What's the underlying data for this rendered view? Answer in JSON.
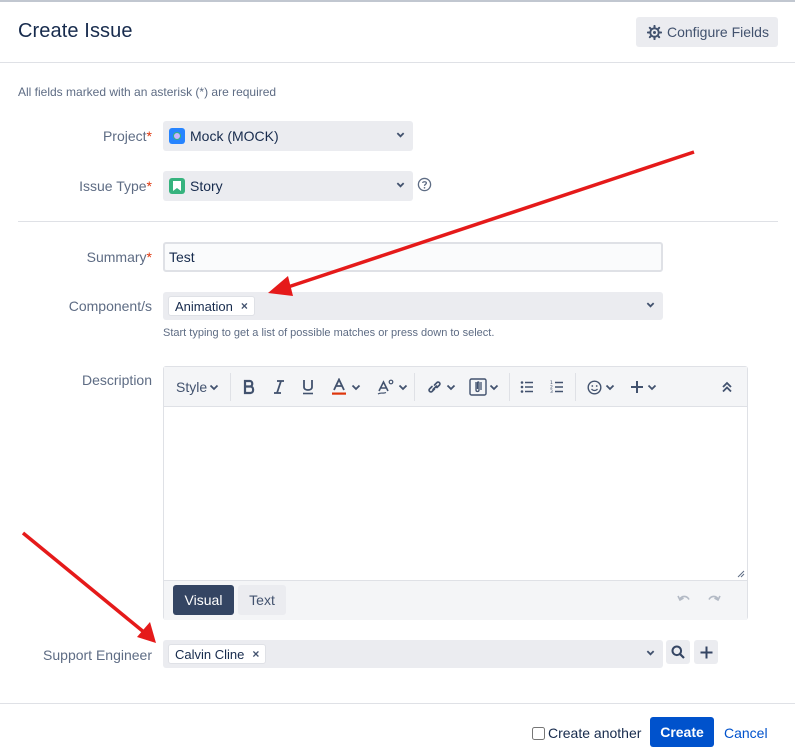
{
  "header": {
    "title": "Create Issue",
    "configure_label": "Configure Fields"
  },
  "required_note": "All fields marked with an asterisk (*) are required",
  "fields": {
    "project": {
      "label": "Project",
      "value": "Mock (MOCK)"
    },
    "issue_type": {
      "label": "Issue Type",
      "value": "Story"
    },
    "summary": {
      "label": "Summary",
      "value": "Test"
    },
    "components": {
      "label": "Component/s",
      "chip": "Animation",
      "hint": "Start typing to get a list of possible matches or press down to select."
    },
    "description": {
      "label": "Description",
      "style_label": "Style",
      "mode_visual": "Visual",
      "mode_text": "Text"
    },
    "support_engineer": {
      "label": "Support Engineer",
      "chip": "Calvin Cline"
    }
  },
  "required_marker": "*",
  "chip_remove": "×",
  "footer": {
    "create_another_label": "Create another",
    "create_label": "Create",
    "cancel_label": "Cancel"
  },
  "colors": {
    "primary": "#0052cc",
    "annotation_arrow": "#e51a1a",
    "required": "#de350b"
  },
  "icons": [
    "gear-icon",
    "project-avatar-icon",
    "story-icon",
    "help-icon",
    "chevron-down-icon",
    "bold-icon",
    "italic-icon",
    "underline-icon",
    "text-color-icon",
    "text-style-icon",
    "link-icon",
    "attachment-icon",
    "bullet-list-icon",
    "numbered-list-icon",
    "emoji-icon",
    "insert-plus-icon",
    "collapse-toolbar-icon",
    "undo-icon",
    "redo-icon",
    "search-icon",
    "plus-icon"
  ]
}
